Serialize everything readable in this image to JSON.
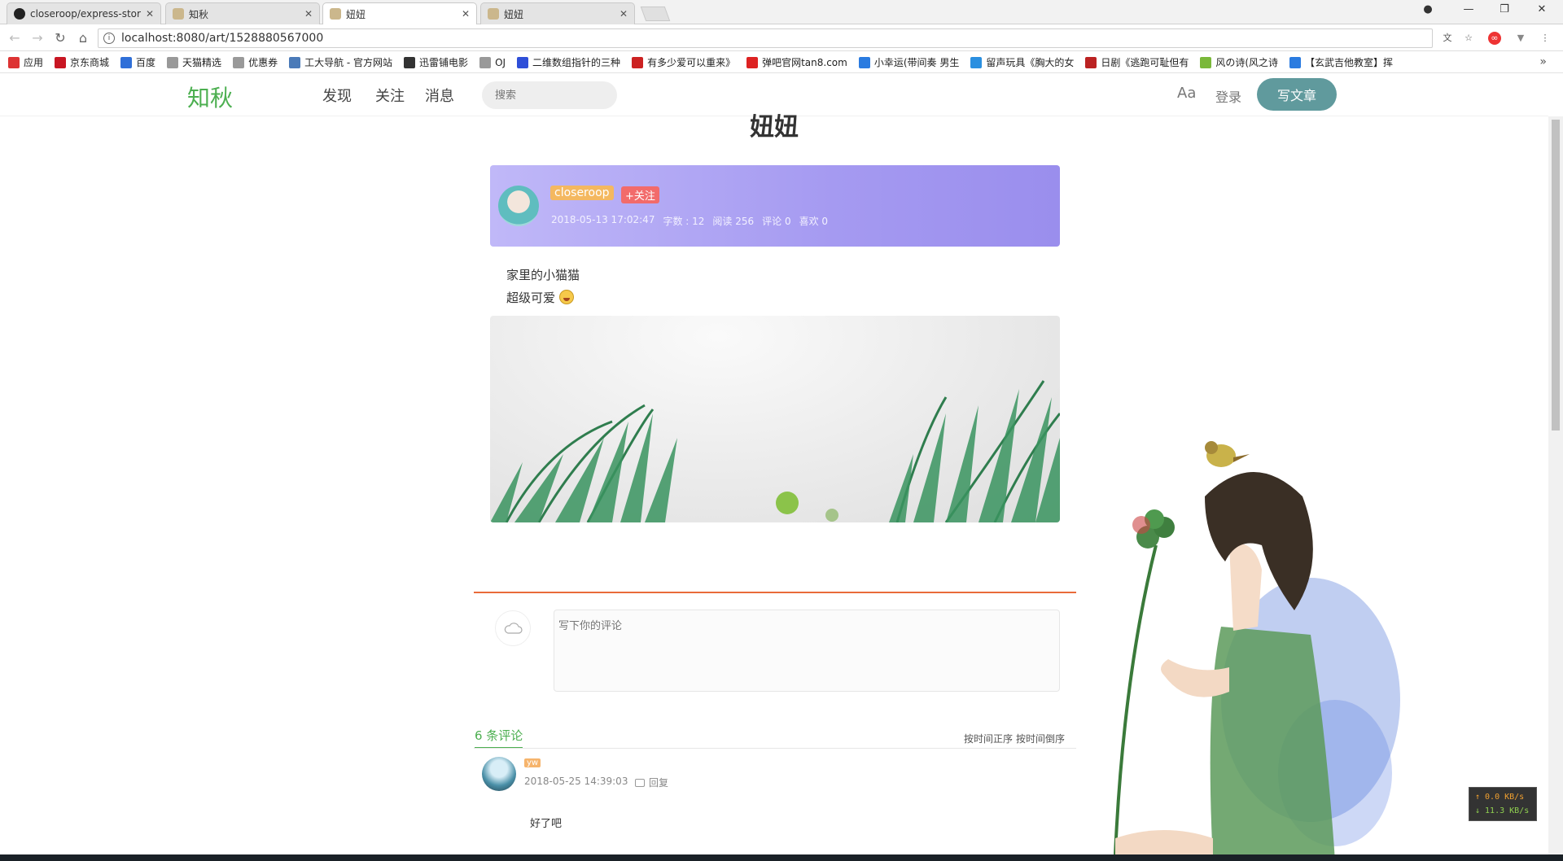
{
  "browser": {
    "tabs": [
      {
        "label": "closeroop/express-stor"
      },
      {
        "label": "知秋"
      },
      {
        "label": "妞妞"
      },
      {
        "label": "妞妞"
      }
    ],
    "url": "localhost:8080/art/1528880567000",
    "bookmarks": [
      {
        "label": "应用",
        "icon": "apps-grid-icon",
        "color": "#d33"
      },
      {
        "label": "京东商城",
        "icon": "jd-icon",
        "color": "#c81623"
      },
      {
        "label": "百度",
        "icon": "baidu-paw-icon",
        "color": "#2f6fd8"
      },
      {
        "label": "天猫精选",
        "icon": "page-icon",
        "color": "#999"
      },
      {
        "label": "优惠券",
        "icon": "page-icon",
        "color": "#999"
      },
      {
        "label": "工大导航 - 官方网站",
        "icon": "globe-icon",
        "color": "#4a7ab8"
      },
      {
        "label": "迅雷铺电影",
        "icon": "pu-icon",
        "color": "#333"
      },
      {
        "label": "OJ",
        "icon": "page-icon",
        "color": "#999"
      },
      {
        "label": "二维数组指针的三种",
        "icon": "paw-icon",
        "color": "#2f4fd8"
      },
      {
        "label": "有多少爱可以重来》",
        "icon": "red-logo-icon",
        "color": "#c22"
      },
      {
        "label": "弹吧官网tan8.com",
        "icon": "tan8-icon",
        "color": "#d22"
      },
      {
        "label": "小幸运(带间奏 男生",
        "icon": "c-logo-icon",
        "color": "#2a7be0"
      },
      {
        "label": "留声玩具《胸大的女",
        "icon": "bird-icon",
        "color": "#2a8fe0"
      },
      {
        "label": "日剧《逃跑可耻但有",
        "icon": "6v-icon",
        "color": "#b22"
      },
      {
        "label": "风の诗(风之诗",
        "icon": "swirl-icon",
        "color": "#7ab83a"
      },
      {
        "label": "【玄武吉他教室】挥",
        "icon": "play-icon",
        "color": "#2a7be0"
      }
    ]
  },
  "header": {
    "logo": "知秋",
    "nav": [
      "发现",
      "关注",
      "消息"
    ],
    "search_placeholder": "搜索",
    "font_toggle": "Aa",
    "login": "登录",
    "write": "写文章",
    "accent": "#609a9d"
  },
  "article": {
    "title": "妞妞",
    "author": "closeroop",
    "follow": "+关注",
    "meta": {
      "date": "2018-05-13 17:02:47",
      "words": "字数 : 12",
      "reads": "阅读 256",
      "comments": "评论 0",
      "likes": "喜欢 0"
    },
    "lines": [
      "家里的小猫猫",
      "超级可爱"
    ]
  },
  "comments": {
    "input_placeholder": "写下你的评论",
    "count": "6 条评论",
    "sort_asc": "按时间正序",
    "sort_desc": "按时间倒序",
    "items": [
      {
        "user": "yw",
        "time": "2018-05-25 14:39:03",
        "reply": "回复",
        "text": "好了吧"
      }
    ]
  },
  "speed_widget": {
    "up": "↑ 0.0 KB/s",
    "down": "↓ 11.3 KB/s"
  }
}
